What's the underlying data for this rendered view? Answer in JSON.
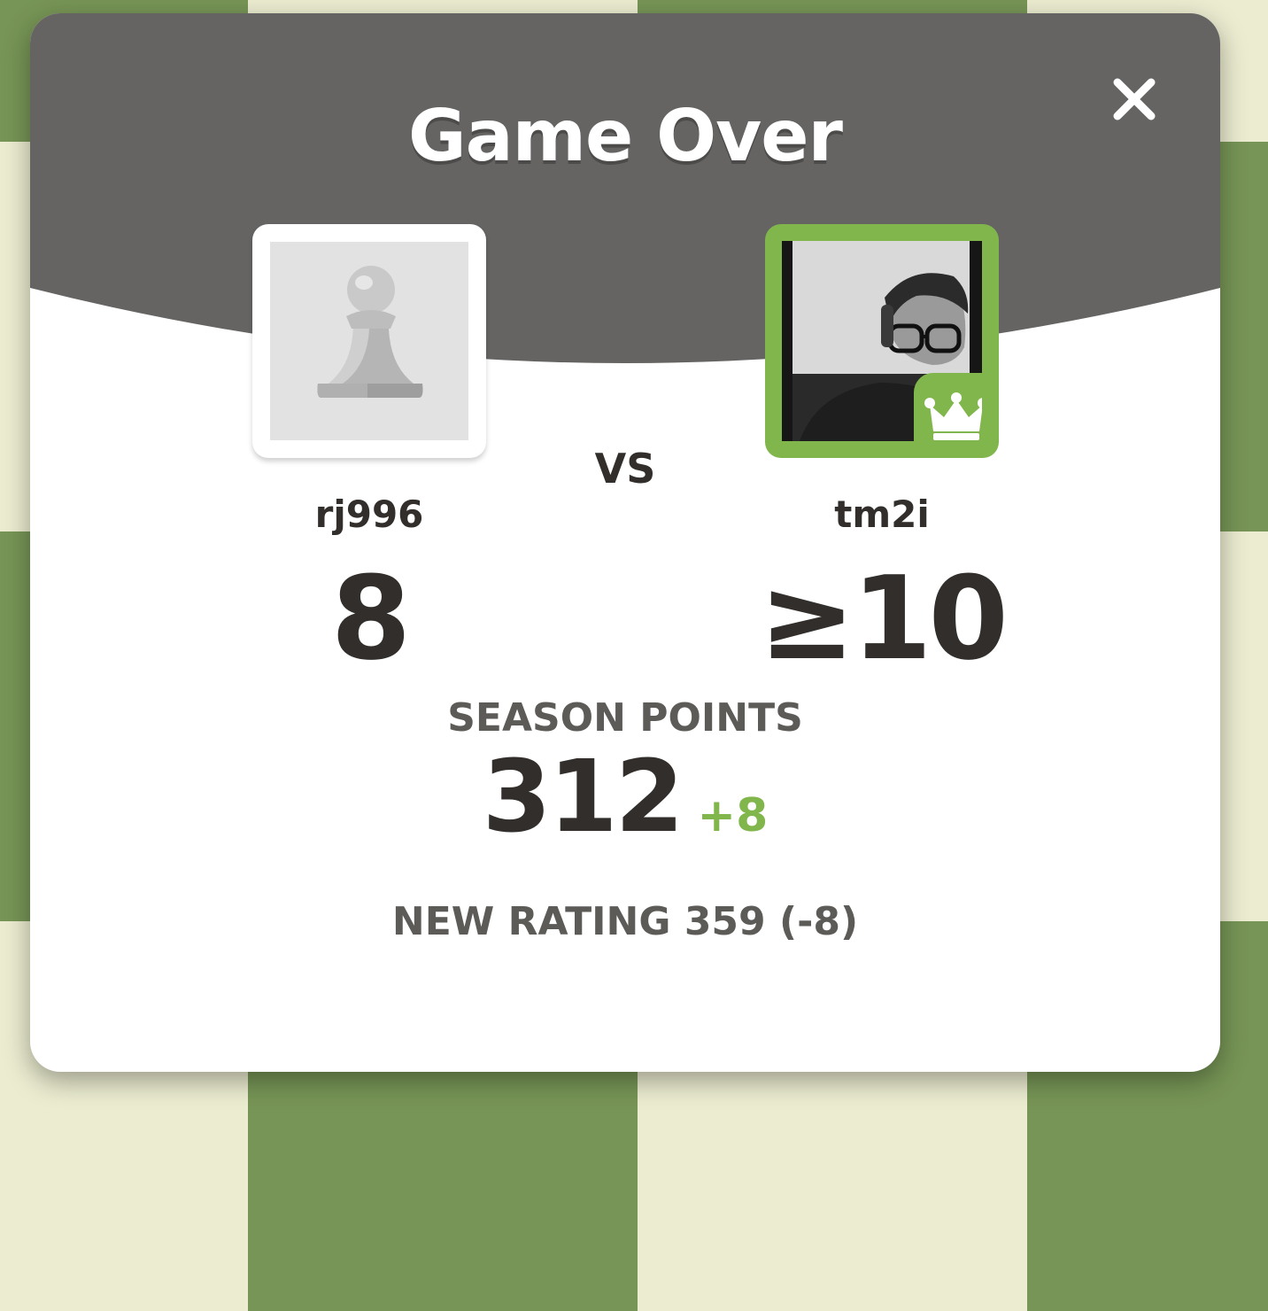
{
  "modal": {
    "title": "Game Over",
    "vs_label": "VS"
  },
  "players": {
    "left": {
      "username": "rj996",
      "score": "8",
      "avatar": "pawn-icon"
    },
    "right": {
      "username": "tm2i",
      "score": "≥10",
      "avatar": "profile-photo",
      "badge": "crown-icon"
    }
  },
  "season": {
    "label": "SEASON POINTS",
    "points": "312",
    "delta": "+8"
  },
  "rating": {
    "text": "NEW RATING 359 (-8)"
  },
  "colors": {
    "header": "#666463",
    "accent_green": "#81b64c",
    "text_dark": "#312e2b",
    "text_muted": "#5d5b58"
  }
}
